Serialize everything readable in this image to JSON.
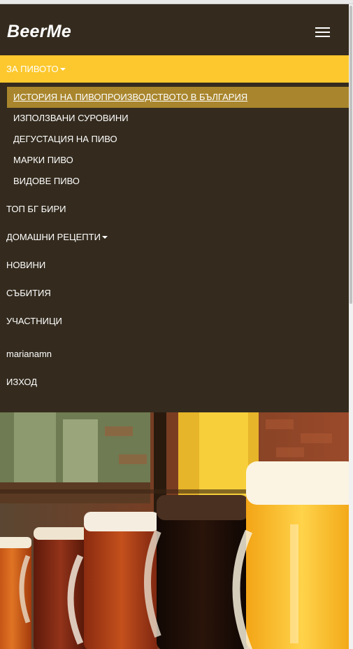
{
  "app": {
    "brand": "BeerMe"
  },
  "menu": {
    "active_item": "ЗА ПИВОТО",
    "submenu": [
      "ИСТОРИЯ НА ПИВОПРОИЗВОДСТВОТО В БЪЛГАРИЯ",
      "ИЗПОЛЗВАНИ СУРОВИНИ",
      "ДЕГУСТАЦИЯ НА ПИВО",
      "МАРКИ ПИВО",
      "ВИДОВЕ ПИВО"
    ],
    "items": [
      "ТОП БГ БИРИ",
      "ДОМАШНИ РЕЦЕПТИ",
      "НОВИНИ",
      "СЪБИТИЯ",
      "УЧАСТНИЦИ"
    ],
    "username": "marianamn",
    "logout": "ИЗХОД"
  },
  "icons": {
    "menu_toggle": "hamburger-menu-icon",
    "dropdown": "caret-down-icon"
  },
  "colors": {
    "navbar_bg": "#342b1e",
    "active_bg": "#fcc82d",
    "selected_bg": "#a9862d"
  }
}
